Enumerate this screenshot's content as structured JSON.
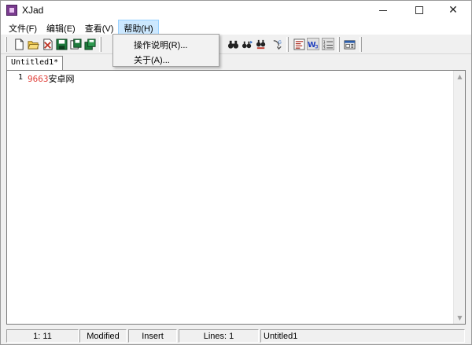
{
  "window": {
    "title": "XJad"
  },
  "menubar": {
    "items": [
      {
        "label": "文件(F)"
      },
      {
        "label": "编辑(E)"
      },
      {
        "label": "查看(V)"
      },
      {
        "label": "帮助(H)"
      }
    ]
  },
  "help_menu": {
    "items": [
      {
        "label": "操作说明(R)..."
      },
      {
        "label": "关于(A)..."
      }
    ]
  },
  "tabs": [
    {
      "label": "Untitled1*"
    }
  ],
  "editor": {
    "line_number": "1",
    "line_number_part": "9663",
    "line_text_part": "安卓网"
  },
  "statusbar": {
    "position": "1: 11",
    "modified": "Modified",
    "mode": "Insert",
    "lines": "Lines: 1",
    "filename": "Untitled1"
  },
  "colors": {
    "number_token": "#e0403a",
    "menu_highlight": "#cce8ff"
  }
}
